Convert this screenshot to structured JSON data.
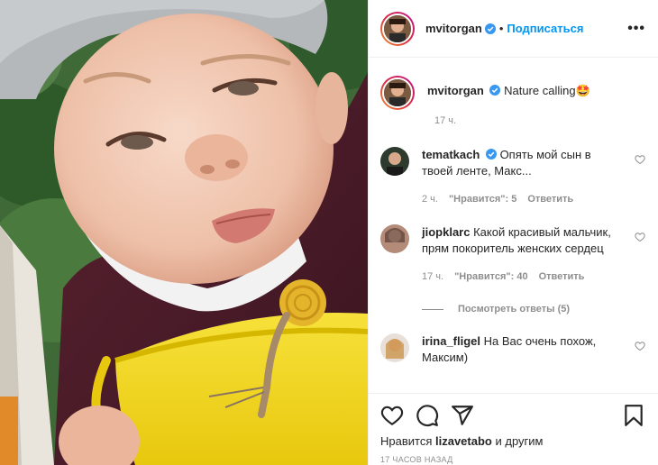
{
  "header": {
    "username": "mvitorgan",
    "dot": "•",
    "follow_label": "Подписаться",
    "more": "•••"
  },
  "caption": {
    "username": "mvitorgan",
    "text": "Nature calling",
    "emoji": "🤩",
    "time": "17 ч."
  },
  "comments": [
    {
      "username": "tematkach",
      "verified": true,
      "text": "Опять мой сын в твоей ленте, Макс...",
      "time": "2 ч.",
      "likes": "\"Нравится\": 5",
      "reply": "Ответить"
    },
    {
      "username": "jiopklarc",
      "verified": false,
      "text": "Какой красивый мальчик, прям покоритель женских сердец",
      "time": "17 ч.",
      "likes": "\"Нравится\": 40",
      "reply": "Ответить",
      "view_replies": "Посмотреть ответы (5)"
    },
    {
      "username": "irina_fligel",
      "verified": false,
      "text": "На Вас очень похож, Максим)"
    }
  ],
  "actions": {
    "likes_prefix": "Нравится",
    "likes_user": "lizavetabo",
    "likes_suffix": "и другим",
    "timestamp": "17 ЧАСОВ НАЗАД"
  },
  "colors": {
    "accent": "#0095f6",
    "verified": "#3897f0",
    "muted": "#8e8e8e",
    "bucket": "#f3d81c"
  },
  "icons": [
    "verified-badge-icon",
    "heart-icon",
    "comment-icon",
    "share-icon",
    "bookmark-icon",
    "more-icon"
  ]
}
